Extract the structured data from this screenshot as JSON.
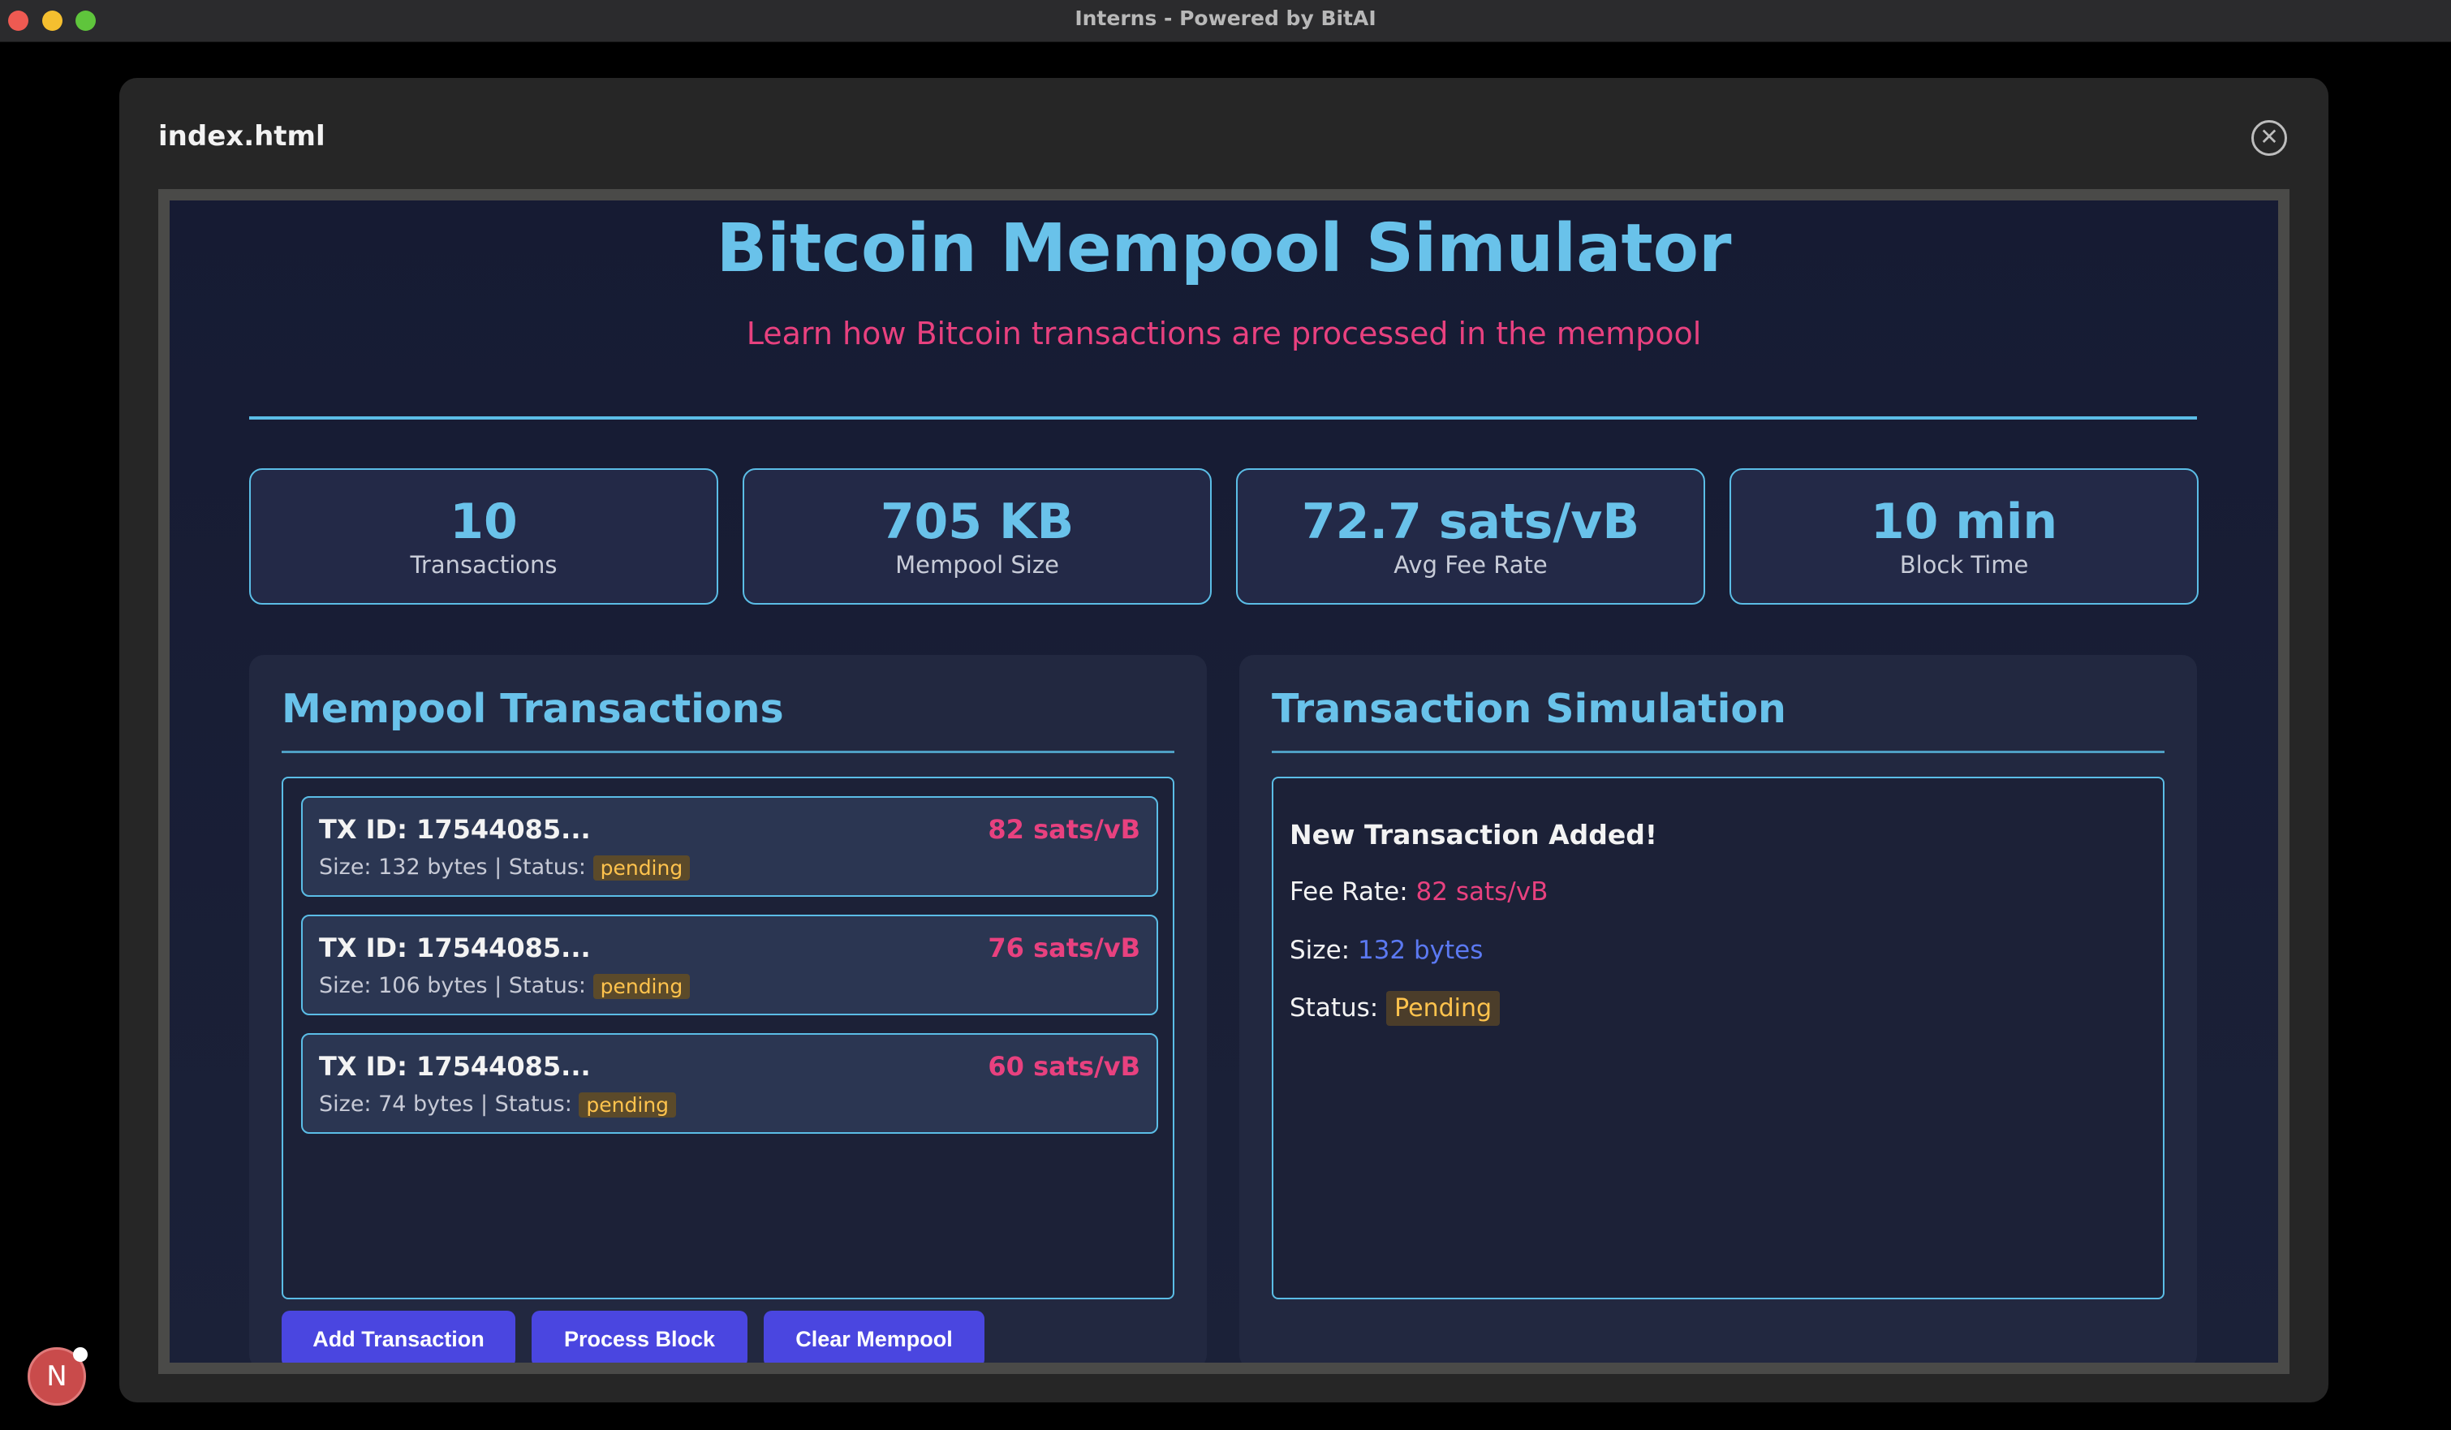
{
  "window": {
    "title": "Interns - Powered by BitAI"
  },
  "modal": {
    "title": "index.html",
    "close_symbol": "✕"
  },
  "app": {
    "title": "Bitcoin Mempool Simulator",
    "subtitle": "Learn how Bitcoin transactions are processed in the mempool"
  },
  "stats": [
    {
      "value": "10",
      "label": "Transactions"
    },
    {
      "value": "705 KB",
      "label": "Mempool Size"
    },
    {
      "value": "72.7 sats/vB",
      "label": "Avg Fee Rate"
    },
    {
      "value": "10 min",
      "label": "Block Time"
    }
  ],
  "mempool": {
    "title": "Mempool Transactions",
    "transactions": [
      {
        "id": "TX ID: 17544085...",
        "fee": "82 sats/vB",
        "meta": "Size: 132 bytes | Status:",
        "status": "pending"
      },
      {
        "id": "TX ID: 17544085...",
        "fee": "76 sats/vB",
        "meta": "Size: 106 bytes | Status:",
        "status": "pending"
      },
      {
        "id": "TX ID: 17544085...",
        "fee": "60 sats/vB",
        "meta": "Size: 74 bytes | Status:",
        "status": "pending"
      }
    ],
    "buttons": {
      "add": "Add Transaction",
      "process": "Process Block",
      "clear": "Clear Mempool"
    }
  },
  "simulation": {
    "title": "Transaction Simulation",
    "heading": "New Transaction Added!",
    "fee_label": "Fee Rate:",
    "fee_value": "82 sats/vB",
    "size_label": "Size:",
    "size_value": "132 bytes",
    "status_label": "Status:",
    "status_value": "Pending"
  },
  "avatar": {
    "initial": "N"
  },
  "colors": {
    "accent": "#69c2ea",
    "pink": "#e8417f",
    "button": "#4a46e0",
    "badge": "#ffc34d"
  }
}
